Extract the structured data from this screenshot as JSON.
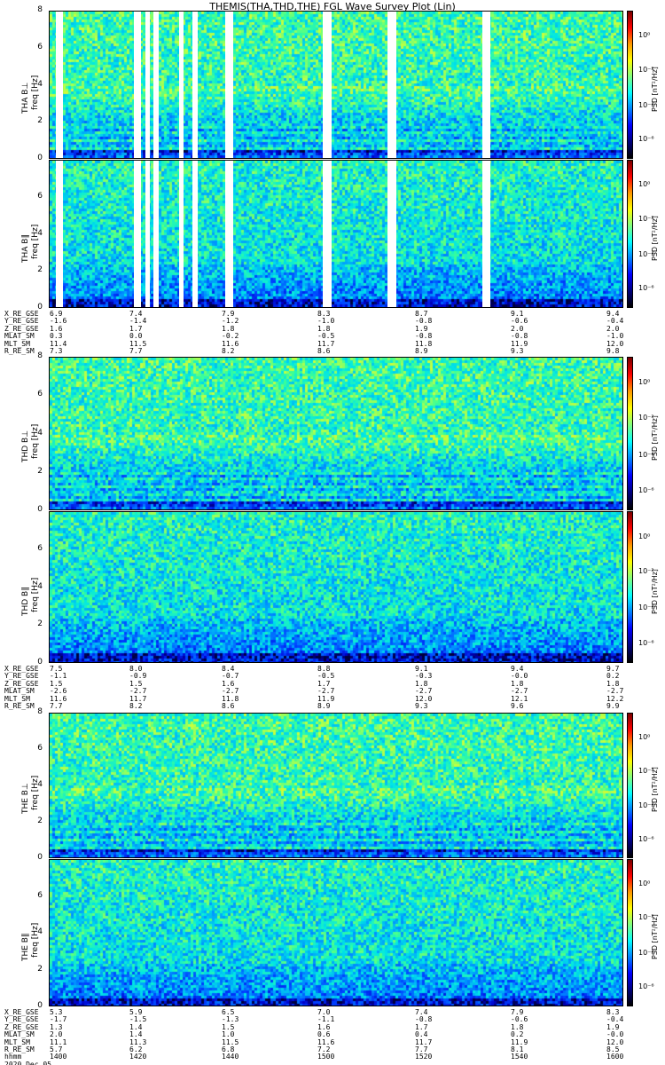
{
  "title": "THEMIS(THA,THD,THE) FGL Wave Survey Plot (Lin)",
  "colorbar": {
    "label": "PSD [nT²/Hz]",
    "ticks": [
      "10⁰",
      "10⁻²",
      "10⁻⁴",
      "10⁻⁶"
    ]
  },
  "blocks": [
    {
      "probe": "THA",
      "panels": [
        {
          "ylabel": "THA B⊥",
          "yunit": "freq [Hz]"
        },
        {
          "ylabel": "THA B∥",
          "yunit": "freq [Hz]"
        }
      ],
      "ephemeris_labels": [
        "X_RE_GSE",
        "Y_RE_GSE",
        "Z_RE_GSE",
        "MLAT_SM",
        "MLT_SM",
        "R_RE_SM"
      ],
      "ephemeris": [
        [
          "6.9",
          "7.4",
          "7.9",
          "8.3",
          "8.7",
          "9.1",
          "9.4"
        ],
        [
          "-1.6",
          "-1.4",
          "-1.2",
          "-1.0",
          "-0.8",
          "-0.6",
          "-0.4"
        ],
        [
          "1.6",
          "1.7",
          "1.8",
          "1.8",
          "1.9",
          "2.0",
          "2.0"
        ],
        [
          "0.3",
          "0.0",
          "-0.2",
          "-0.5",
          "-0.8",
          "-0.8",
          "-1.0"
        ],
        [
          "11.4",
          "11.5",
          "11.6",
          "11.7",
          "11.8",
          "11.9",
          "12.0"
        ],
        [
          "7.3",
          "7.7",
          "8.2",
          "8.6",
          "8.9",
          "9.3",
          "9.8"
        ]
      ]
    },
    {
      "probe": "THD",
      "panels": [
        {
          "ylabel": "THD B⊥",
          "yunit": "freq [Hz]"
        },
        {
          "ylabel": "THD B∥",
          "yunit": "freq [Hz]"
        }
      ],
      "ephemeris_labels": [
        "X_RE_GSE",
        "Y_RE_GSE",
        "Z_RE_GSE",
        "MLAT_SM",
        "MLT_SM",
        "R_RE_SM"
      ],
      "ephemeris": [
        [
          "7.5",
          "8.0",
          "8.4",
          "8.8",
          "9.1",
          "9.4",
          "9.7"
        ],
        [
          "-1.1",
          "-0.9",
          "-0.7",
          "-0.5",
          "-0.3",
          "-0.0",
          "0.2"
        ],
        [
          "1.5",
          "1.5",
          "1.6",
          "1.7",
          "1.8",
          "1.8",
          "1.8"
        ],
        [
          "-2.6",
          "-2.7",
          "-2.7",
          "-2.7",
          "-2.7",
          "-2.7",
          "-2.7"
        ],
        [
          "11.6",
          "11.7",
          "11.8",
          "11.9",
          "12.0",
          "12.1",
          "12.2"
        ],
        [
          "7.7",
          "8.2",
          "8.6",
          "8.9",
          "9.3",
          "9.6",
          "9.9"
        ]
      ]
    },
    {
      "probe": "THE",
      "panels": [
        {
          "ylabel": "THE B⊥",
          "yunit": "freq [Hz]"
        },
        {
          "ylabel": "THE B∥",
          "yunit": "freq [Hz]"
        }
      ],
      "ephemeris_labels": [
        "X_RE_GSE",
        "Y_RE_GSE",
        "Z_RE_GSE",
        "MLAT_SM",
        "MLT_SM",
        "R_RE_SM",
        "hhmm"
      ],
      "ephemeris": [
        [
          "5.3",
          "5.9",
          "6.5",
          "7.0",
          "7.4",
          "7.9",
          "8.3"
        ],
        [
          "-1.7",
          "-1.5",
          "-1.3",
          "-1.1",
          "-0.8",
          "-0.6",
          "-0.4"
        ],
        [
          "1.3",
          "1.4",
          "1.5",
          "1.6",
          "1.7",
          "1.8",
          "1.9"
        ],
        [
          "2.0",
          "1.4",
          "1.0",
          "0.6",
          "0.4",
          "0.2",
          "-0.0"
        ],
        [
          "11.1",
          "11.3",
          "11.5",
          "11.6",
          "11.7",
          "11.9",
          "12.0"
        ],
        [
          "5.7",
          "6.2",
          "6.8",
          "7.2",
          "7.7",
          "8.1",
          "8.5"
        ],
        [
          "1400",
          "1420",
          "1440",
          "1500",
          "1520",
          "1540",
          "1600"
        ]
      ],
      "date": "2020 Dec 05"
    }
  ],
  "chart_data": [
    {
      "type": "heatmap",
      "title": "THEMIS(THA,THD,THE) FGL Wave Survey Plot (Lin)",
      "ylabel": "THA B⊥ freq [Hz]",
      "ylim": [
        0,
        8
      ],
      "yticks": [
        0,
        2,
        4,
        6,
        8
      ],
      "xlim": [
        "1400",
        "1600"
      ],
      "colorbar_label": "PSD [nT²/Hz]",
      "colorbar_range": [
        "10⁻⁶",
        "10⁰"
      ],
      "data_gaps": true
    },
    {
      "type": "heatmap",
      "ylabel": "THA B∥ freq [Hz]",
      "ylim": [
        0,
        8
      ],
      "yticks": [
        0,
        2,
        4,
        6
      ],
      "data_gaps": true
    },
    {
      "type": "heatmap",
      "ylabel": "THD B⊥ freq [Hz]",
      "ylim": [
        0,
        8
      ],
      "yticks": [
        0,
        2,
        4,
        6,
        8
      ],
      "data_gaps": false
    },
    {
      "type": "heatmap",
      "ylabel": "THD B∥ freq [Hz]",
      "ylim": [
        0,
        8
      ],
      "yticks": [
        0,
        2,
        4,
        6
      ],
      "data_gaps": false
    },
    {
      "type": "heatmap",
      "ylabel": "THE B⊥ freq [Hz]",
      "ylim": [
        0,
        8
      ],
      "yticks": [
        0,
        2,
        4,
        6,
        8
      ],
      "data_gaps": false
    },
    {
      "type": "heatmap",
      "ylabel": "THE B∥ freq [Hz]",
      "ylim": [
        0,
        8
      ],
      "yticks": [
        0,
        2,
        4,
        6
      ],
      "data_gaps": false
    }
  ]
}
